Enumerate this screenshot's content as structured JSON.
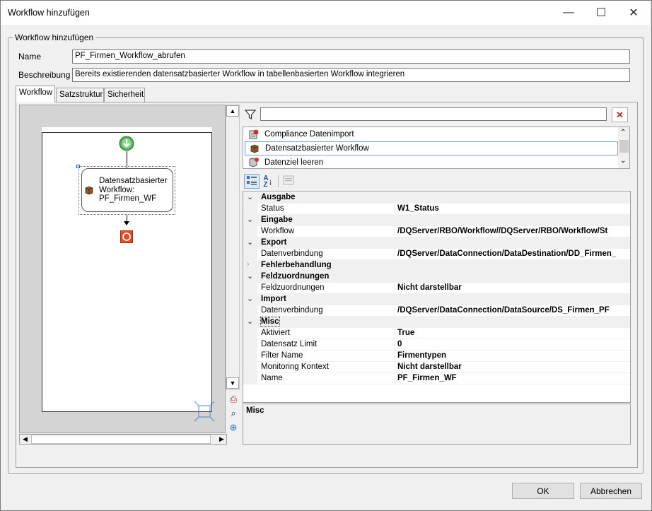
{
  "window": {
    "title": "Workflow hinzufügen",
    "minimize": "—",
    "maximize": "☐",
    "close": "✕"
  },
  "group": {
    "legend": "Workflow hinzufügen",
    "name_label": "Name",
    "name_value": "PF_Firmen_Workflow_abrufen",
    "desc_label": "Beschreibung",
    "desc_value": "Bereits existierenden datensatzbasierter Workflow in  tabellenbasierten Workflow integrieren"
  },
  "tabs": [
    "Workflow",
    "Satzstruktur",
    "Sicherheit"
  ],
  "designer": {
    "node_label": "Datensatzbasierter Workflow: PF_Firmen_WF",
    "node_line1": "Datensatzbasierter",
    "node_line2": "Workflow:",
    "node_line3": "PF_Firmen_WF"
  },
  "toolbox": {
    "filter_value": "",
    "items": [
      {
        "label": "Compliance Datenimport",
        "icon": "compliance-icon"
      },
      {
        "label": "Datensatzbasierter Workflow",
        "icon": "box-icon"
      },
      {
        "label": "Datenziel leeren",
        "icon": "database-clear-icon"
      }
    ]
  },
  "properties": {
    "categories": [
      {
        "name": "Ausgabe",
        "expanded": true,
        "props": [
          {
            "name": "Status",
            "value": "W1_Status"
          }
        ]
      },
      {
        "name": "Eingabe",
        "expanded": true,
        "props": [
          {
            "name": "Workflow",
            "value": "/DQServer/RBO/Workflow//DQServer/RBO/Workflow/St"
          }
        ]
      },
      {
        "name": "Export",
        "expanded": true,
        "props": [
          {
            "name": "Datenverbindung",
            "value": "/DQServer/DataConnection/DataDestination/DD_Firmen_"
          }
        ]
      },
      {
        "name": "Fehlerbehandlung",
        "expanded": false,
        "props": []
      },
      {
        "name": "Feldzuordnungen",
        "expanded": true,
        "props": [
          {
            "name": "Feldzuordnungen",
            "value": "Nicht darstellbar"
          }
        ]
      },
      {
        "name": "Import",
        "expanded": true,
        "props": [
          {
            "name": "Datenverbindung",
            "value": "/DQServer/DataConnection/DataSource/DS_Firmen_PF"
          }
        ]
      },
      {
        "name": "Misc",
        "expanded": true,
        "props": [
          {
            "name": "Aktiviert",
            "value": "True"
          },
          {
            "name": "Datensatz Limit",
            "value": "0"
          },
          {
            "name": "Filter Name",
            "value": "Firmentypen"
          },
          {
            "name": "Monitoring Kontext",
            "value": "Nicht darstellbar"
          },
          {
            "name": "Name",
            "value": "PF_Firmen_WF"
          }
        ]
      }
    ],
    "description_title": "Misc"
  },
  "buttons": {
    "ok": "OK",
    "cancel": "Abbrechen"
  }
}
